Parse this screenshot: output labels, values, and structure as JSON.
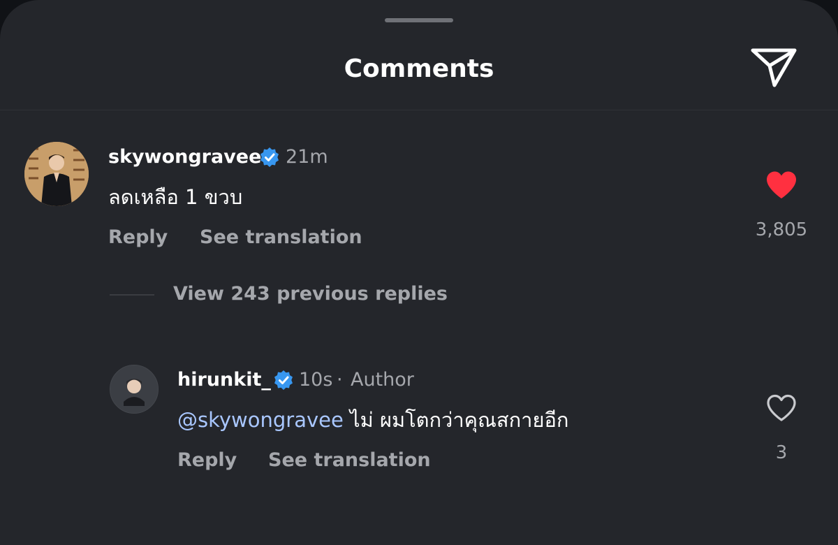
{
  "header": {
    "title": "Comments"
  },
  "comments": [
    {
      "username": "skywongravee",
      "time": "21m",
      "text": "ลดเหลือ 1 ขวบ",
      "reply_label": "Reply",
      "translate_label": "See translation",
      "likes": "3,805",
      "liked": true
    }
  ],
  "replies_toggle": {
    "label": "View 243 previous replies"
  },
  "replies": [
    {
      "username": "hirunkit_",
      "time": "10s",
      "separator": "·",
      "badge": "Author",
      "mention": "@skywongravee",
      "text": " ไม่ ผมโตกว่าคุณสกายอีก",
      "reply_label": "Reply",
      "translate_label": "See translation",
      "likes": "3",
      "liked": false
    }
  ],
  "colors": {
    "background": "#24262b",
    "text_primary": "#ffffff",
    "text_secondary": "#a5a7ac",
    "mention": "#a9c7ff",
    "verified": "#3897f0",
    "like_active": "#ff3040"
  },
  "icons": {
    "send": "paper-plane-icon",
    "verified": "verified-badge-icon",
    "like_filled": "heart-filled-icon",
    "like_outline": "heart-outline-icon"
  }
}
